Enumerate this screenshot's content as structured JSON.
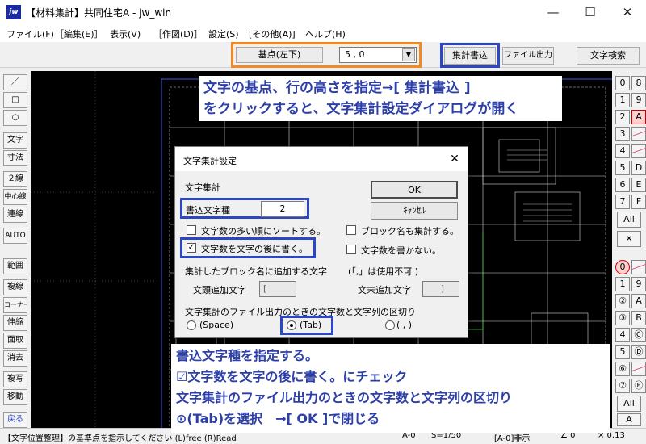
{
  "window": {
    "title": "【材料集計】共同住宅A - jw_win",
    "icon": "jw",
    "minimize": "—",
    "maximize": "☐",
    "close": "✕"
  },
  "menu": [
    "ファイル(F)",
    "［編集(E)］",
    "表示(V)",
    "［作図(D)］",
    "設定(S)",
    "[その他(A)]",
    "ヘルプ(H)"
  ],
  "toolbar": {
    "basepoint_label": "基点(左下)",
    "line_height_value": "5 , 0",
    "dropdown_arrow": "▼",
    "tally_write": "集計書込",
    "file_output": "ファイル出力",
    "text_search": "文字検索"
  },
  "left_tools": [
    "／",
    "□",
    "○",
    "文字",
    "寸法",
    "２線",
    "中心線",
    "連線",
    "AUTO",
    "範囲",
    "複線",
    "コーナー",
    "伸縮",
    "面取",
    "消去",
    "複写",
    "移動",
    "戻る"
  ],
  "right_tools": {
    "layer_left": [
      "0",
      "1",
      "2",
      "3",
      "4",
      "5",
      "6",
      "7"
    ],
    "layer_right": [
      "8",
      "9",
      "A",
      "",
      "",
      "D",
      "E",
      "F"
    ],
    "all_label": "All",
    "x_label": "✕",
    "group_left": [
      "0",
      "1",
      "②",
      "③",
      "4",
      "5",
      "⑥",
      "⑦"
    ],
    "group_right": [
      "",
      "9",
      "A",
      "B",
      "Ⓒ",
      "Ⓓ",
      "",
      "Ⓕ"
    ],
    "all2_label": "All",
    "a_label": "A"
  },
  "callouts": {
    "top_line1": "文字の基点、行の高さを指定→[ 集計書込 ]",
    "top_line2": "をクリックすると、文字集計設定ダイアログが開く",
    "bottom_line1": "書込文字種を指定する。",
    "bottom_line2": "☑文字数を文字の後に書く。にチェック",
    "bottom_line3": "文字集計のファイル出力のときの文字数と文字列の区切り",
    "bottom_line4": "⊙(Tab)を選択　→[ OK ]で閉じる"
  },
  "dialog": {
    "title": "文字集計設定",
    "close": "✕",
    "section_label": "文字集計",
    "ok_button": "OK",
    "cancel_button": "ｷｬﾝｾﾙ",
    "write_type_label": "書込文字種",
    "write_type_value": "2",
    "sort_by_count": "文字数の多い順にソートする。",
    "sort_by_count_checked": false,
    "tally_block_names": "ブロック名も集計する。",
    "tally_block_names_checked": false,
    "write_count_after": "文字数を文字の後に書く。",
    "write_count_after_checked": true,
    "no_count": "文字数を書かない。",
    "no_count_checked": false,
    "block_name_prefix_heading": "集計したブロック名に追加する文字",
    "bracket_note": "(「,」は使用不可 )",
    "prefix_label": "文頭追加文字",
    "prefix_value": "[",
    "suffix_label": "文末追加文字",
    "suffix_value": "]",
    "separator_heading": "文字集計のファイル出力のときの文字数と文字列の区切り",
    "sep_space": "(Space)",
    "sep_tab": "(Tab)",
    "sep_comma": "( , )",
    "selected_separator": "Tab"
  },
  "statusbar": {
    "hint": "【文字位置整理】の基準点を指示してください (L)free (R)Read",
    "paper": "A-0",
    "scale": "S=1/50",
    "layer": "[A-0]非示",
    "angle": "∠ 0",
    "zoom": "× 0.13"
  },
  "colors": {
    "callout_text": "#2c3fa8",
    "highlight_blue": "#2c46c8",
    "highlight_orange": "#f08a24",
    "canvas_bg": "#000000",
    "selected_layer": "#cc0000"
  }
}
